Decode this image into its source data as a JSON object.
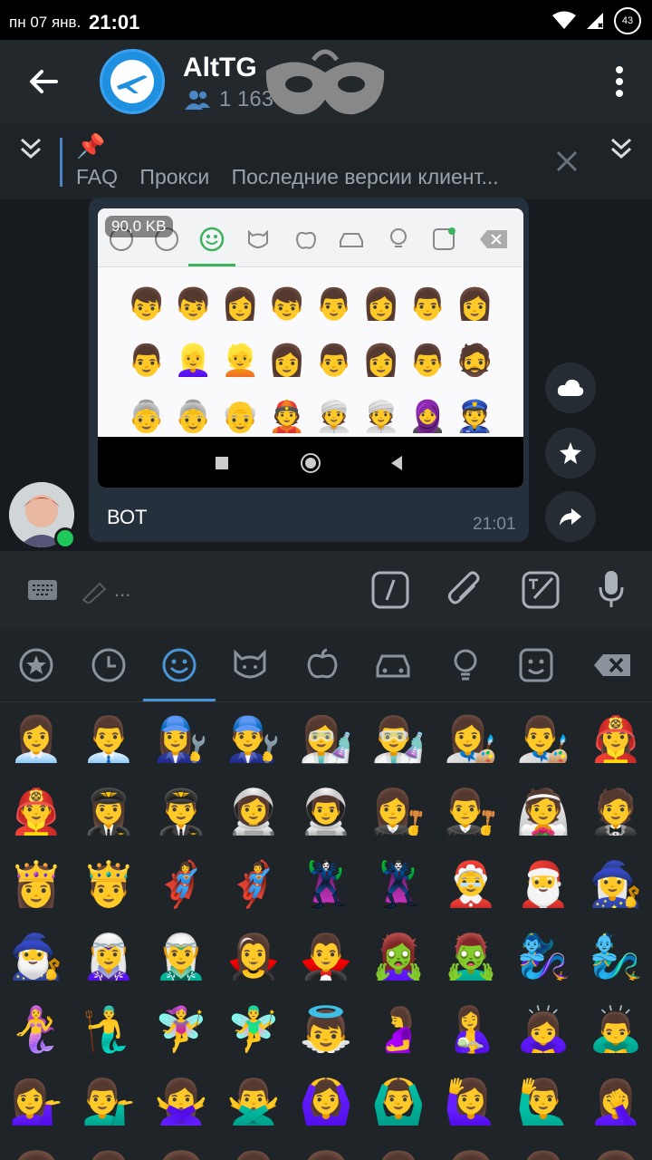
{
  "statusbar": {
    "date": "пн 07 янв.",
    "time": "21:01",
    "battery": "43"
  },
  "header": {
    "title": "AltTG",
    "members": "1 163"
  },
  "pinned": {
    "emoji": "📌",
    "items": [
      "FAQ",
      "Прокси",
      "Последние версии клиент..."
    ]
  },
  "message": {
    "image_size": "90,0 KB",
    "caption": "ВОТ",
    "time": "21:01",
    "emoji_rows": [
      "👦 👦 👩 👦 👨 👩 👨 👩",
      "👨 👱‍♀️ 👱 👩 👨 👩 👨 🧔",
      "👵 👵 👴 👲 👳 👳 🧕 👮"
    ]
  },
  "input": {
    "placeholder": "..."
  },
  "emoji_panel": {
    "rows": [
      [
        "👩‍💼",
        "👨‍💼",
        "👩‍🔧",
        "👨‍🔧",
        "👩‍🔬",
        "👨‍🔬",
        "👩‍🎨",
        "👨‍🎨",
        "👩‍🚒"
      ],
      [
        "👨‍🚒",
        "👩‍✈️",
        "👨‍✈️",
        "👩‍🚀",
        "👨‍🚀",
        "👩‍⚖️",
        "👨‍⚖️",
        "👰",
        "🤵"
      ],
      [
        "👸",
        "🤴",
        "🦸‍♀️",
        "🦸‍♂️",
        "🦹‍♀️",
        "🦹‍♂️",
        "🤶",
        "🎅",
        "🧙‍♀️"
      ],
      [
        "🧙‍♂️",
        "🧝‍♀️",
        "🧝‍♂️",
        "🧛‍♀️",
        "🧛‍♂️",
        "🧟‍♀️",
        "🧟‍♂️",
        "🧞‍♀️",
        "🧞‍♂️"
      ],
      [
        "🧜‍♀️",
        "🧜‍♂️",
        "🧚‍♀️",
        "🧚‍♂️",
        "👼",
        "🤰",
        "🤱",
        "🙇‍♀️",
        "🙇‍♂️"
      ],
      [
        "💁‍♀️",
        "💁‍♂️",
        "🙅‍♀️",
        "🙅‍♂️",
        "🙆‍♀️",
        "🙆‍♂️",
        "🙋‍♀️",
        "🙋‍♂️",
        "🤦‍♀️"
      ],
      [
        "👩",
        "👨",
        "👩",
        "👨",
        "👩",
        "👨",
        "👩",
        "👨",
        "👩"
      ]
    ]
  }
}
